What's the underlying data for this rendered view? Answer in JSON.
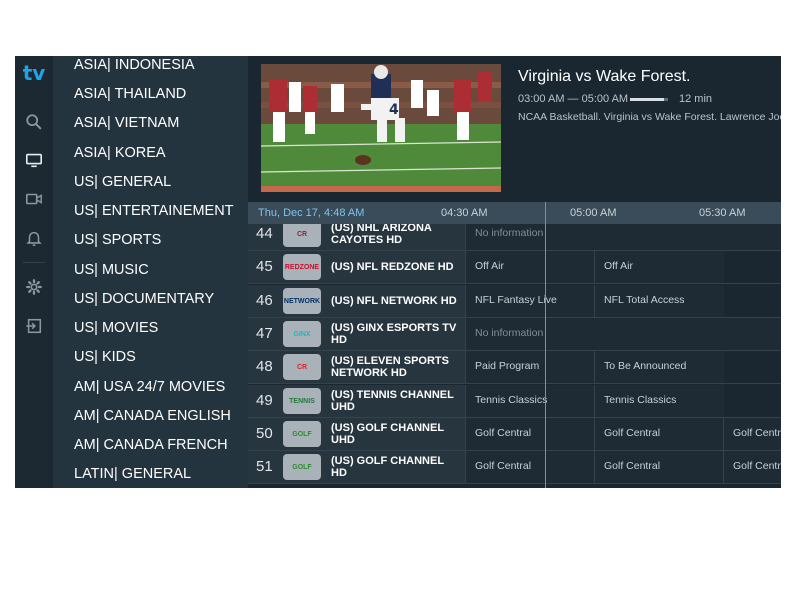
{
  "app": {
    "logo": "tv"
  },
  "rail_icons": [
    "search-icon",
    "tv-icon",
    "video-camera-icon",
    "bell-icon",
    "gear-icon",
    "logout-icon"
  ],
  "categories": [
    "ASIA| INDONESIA",
    "ASIA| THAILAND",
    "ASIA| VIETNAM",
    "ASIA| KOREA",
    "US| GENERAL",
    "US| ENTERTAINEMENT",
    "US| SPORTS",
    "US| MUSIC",
    "US| DOCUMENTARY",
    "US| MOVIES",
    "US| KIDS",
    "AM| USA 24/7 MOVIES",
    "AM| CANADA ENGLISH",
    "AM| CANADA FRENCH",
    "LATIN| GENERAL"
  ],
  "now_playing": {
    "title": "Virginia vs Wake Forest.",
    "time_range": "03:00 AM — 05:00 AM",
    "remaining": "12 min",
    "progress": 0.9,
    "description": "NCAA Basketball. Virginia vs Wake Forest. Lawrence Joe"
  },
  "timeline": {
    "date": "Thu, Dec 17, 4:48 AM",
    "slots": [
      "04:30 AM",
      "05:00 AM",
      "05:30 AM"
    ]
  },
  "channels": [
    {
      "number": "44",
      "name": "(US) NHL ARIZONA CAYOTES HD",
      "logo": "CR",
      "logo_color": "#8c2633",
      "programs": [
        {
          "title": "No information",
          "dim": true
        }
      ]
    },
    {
      "number": "45",
      "name": "(US) NFL REDZONE HD",
      "logo": "REDZONE",
      "logo_color": "#c8102e",
      "programs": [
        {
          "title": "Off Air"
        },
        {
          "title": "Off Air"
        }
      ]
    },
    {
      "number": "46",
      "name": "(US) NFL NETWORK HD",
      "logo": "NETWORK",
      "logo_color": "#013369",
      "programs": [
        {
          "title": "NFL Fantasy Live"
        },
        {
          "title": "NFL Total Access"
        }
      ]
    },
    {
      "number": "47",
      "name": "(US) GINX ESPORTS TV HD",
      "logo": "GINX",
      "logo_color": "#1fb5c4",
      "programs": [
        {
          "title": "No information",
          "dim": true
        }
      ]
    },
    {
      "number": "48",
      "name": "(US) ELEVEN SPORTS NETWORK HD",
      "logo": "CR",
      "logo_color": "#d6262f",
      "programs": [
        {
          "title": "Paid Program"
        },
        {
          "title": "To Be Announced"
        }
      ]
    },
    {
      "number": "49",
      "name": "(US) TENNIS CHANNEL UHD",
      "logo": "TENNIS",
      "logo_color": "#1f7a3a",
      "programs": [
        {
          "title": "Tennis Classics"
        },
        {
          "title": "Tennis Classics"
        }
      ]
    },
    {
      "number": "50",
      "name": "(US) GOLF CHANNEL UHD",
      "logo": "GOLF",
      "logo_color": "#2e8b2e",
      "programs": [
        {
          "title": "Golf Central"
        },
        {
          "title": "Golf Central"
        },
        {
          "title": "Golf Central"
        }
      ]
    },
    {
      "number": "51",
      "name": "(US) GOLF CHANNEL HD",
      "logo": "GOLF",
      "logo_color": "#2e8b2e",
      "programs": [
        {
          "title": "Golf Central"
        },
        {
          "title": "Golf Central"
        },
        {
          "title": "Golf Central"
        }
      ]
    }
  ]
}
